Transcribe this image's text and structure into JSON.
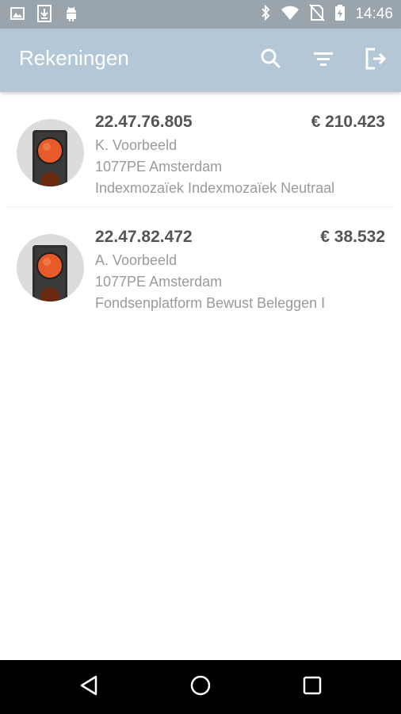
{
  "status_bar": {
    "time": "14:46",
    "left_icons": [
      "image-icon",
      "download-icon",
      "android-icon"
    ],
    "right_icons": [
      "bluetooth-icon",
      "wifi-icon",
      "no-sim-icon",
      "battery-charging-icon"
    ]
  },
  "app_bar": {
    "title": "Rekeningen",
    "actions": [
      "search-icon",
      "filter-icon",
      "logout-icon"
    ]
  },
  "accounts": [
    {
      "number": "22.47.76.805",
      "amount": "€ 210.423",
      "holder": "K. Voorbeeld",
      "address": "1077PE  Amsterdam",
      "product": "Indexmozaïek Indexmozaïek Neutraal",
      "status_icon": "traffic-light-icon"
    },
    {
      "number": "22.47.82.472",
      "amount": "€ 38.532",
      "holder": "A. Voorbeeld",
      "address": "1077PE  Amsterdam",
      "product": "Fondsenplatform Bewust Beleggen I",
      "status_icon": "traffic-light-icon"
    }
  ],
  "nav_bar": {
    "buttons": [
      "back-icon",
      "home-icon",
      "recents-icon"
    ]
  },
  "colors": {
    "status_bar": "#9aa4ad",
    "app_bar": "#b3c7d6",
    "primary_text": "#555555",
    "secondary_text": "#9a9a9a",
    "traffic_light_red": "#e85a2a"
  }
}
